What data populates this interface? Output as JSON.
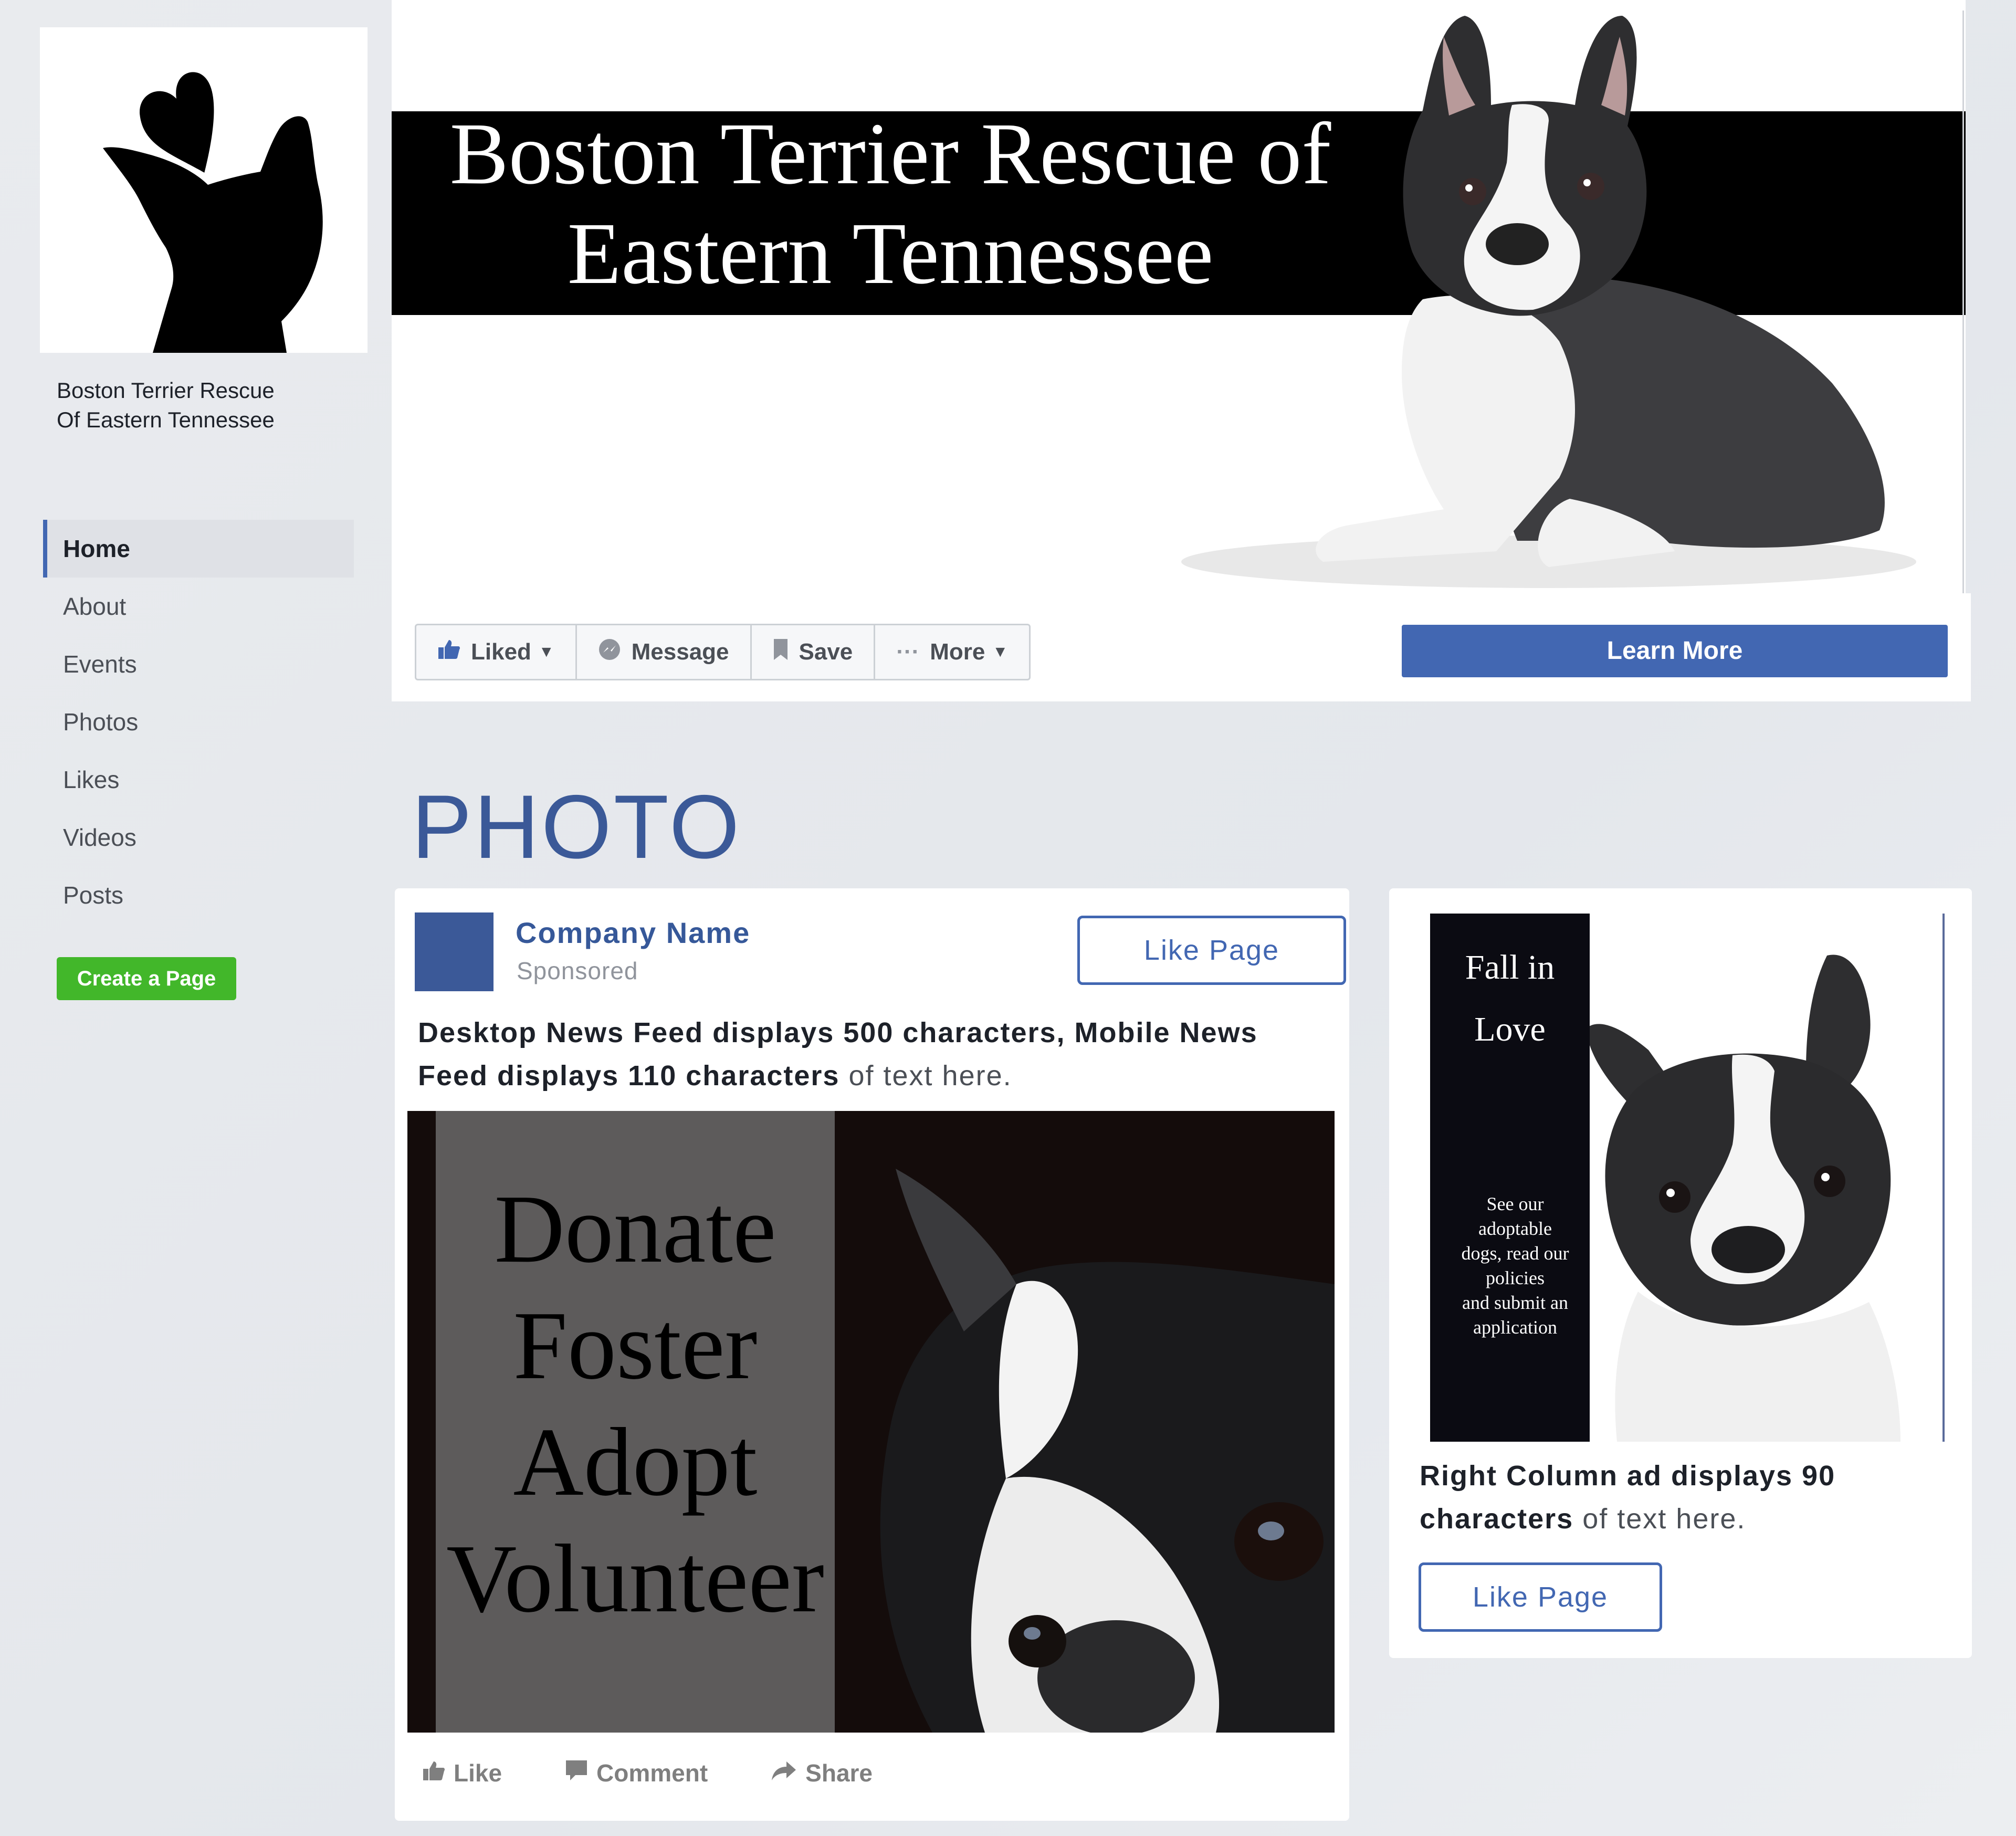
{
  "page": {
    "name": "Boston Terrier Rescue\nOf Eastern Tennessee"
  },
  "sidebar": {
    "items": [
      {
        "label": "Home",
        "active": true
      },
      {
        "label": "About"
      },
      {
        "label": "Events"
      },
      {
        "label": "Photos"
      },
      {
        "label": "Likes"
      },
      {
        "label": "Videos"
      },
      {
        "label": "Posts"
      }
    ],
    "create_page_label": "Create a Page"
  },
  "cover": {
    "title_line1": "Boston Terrier Rescue of",
    "title_line2": "Eastern Tennessee"
  },
  "actions": {
    "liked": "Liked",
    "message": "Message",
    "save": "Save",
    "more": "More",
    "learn_more": "Learn More"
  },
  "section_heading": "PHOTO",
  "feed_ad": {
    "company_name": "Company Name",
    "sponsored": "Sponsored",
    "like_page": "Like Page",
    "text_bold": "Desktop News Feed displays 500 characters, Mobile News Feed displays 110 characters",
    "text_rest": " of text here.",
    "image_lines": [
      "Donate",
      "Foster",
      "Adopt",
      "Volunteer"
    ],
    "like": "Like",
    "comment": "Comment",
    "share": "Share"
  },
  "right_ad": {
    "title_line1": "Fall in",
    "title_line2": "Love",
    "small_text": "See our\nadoptable\ndogs, read our\npolicies\nand submit an\napplication",
    "text_bold": "Right Column ad displays 90 characters",
    "text_rest": " of text here.",
    "like_page": "Like Page"
  },
  "colors": {
    "facebook_blue": "#4267b2",
    "heading_blue": "#3b5998",
    "create_green": "#42b72a"
  }
}
